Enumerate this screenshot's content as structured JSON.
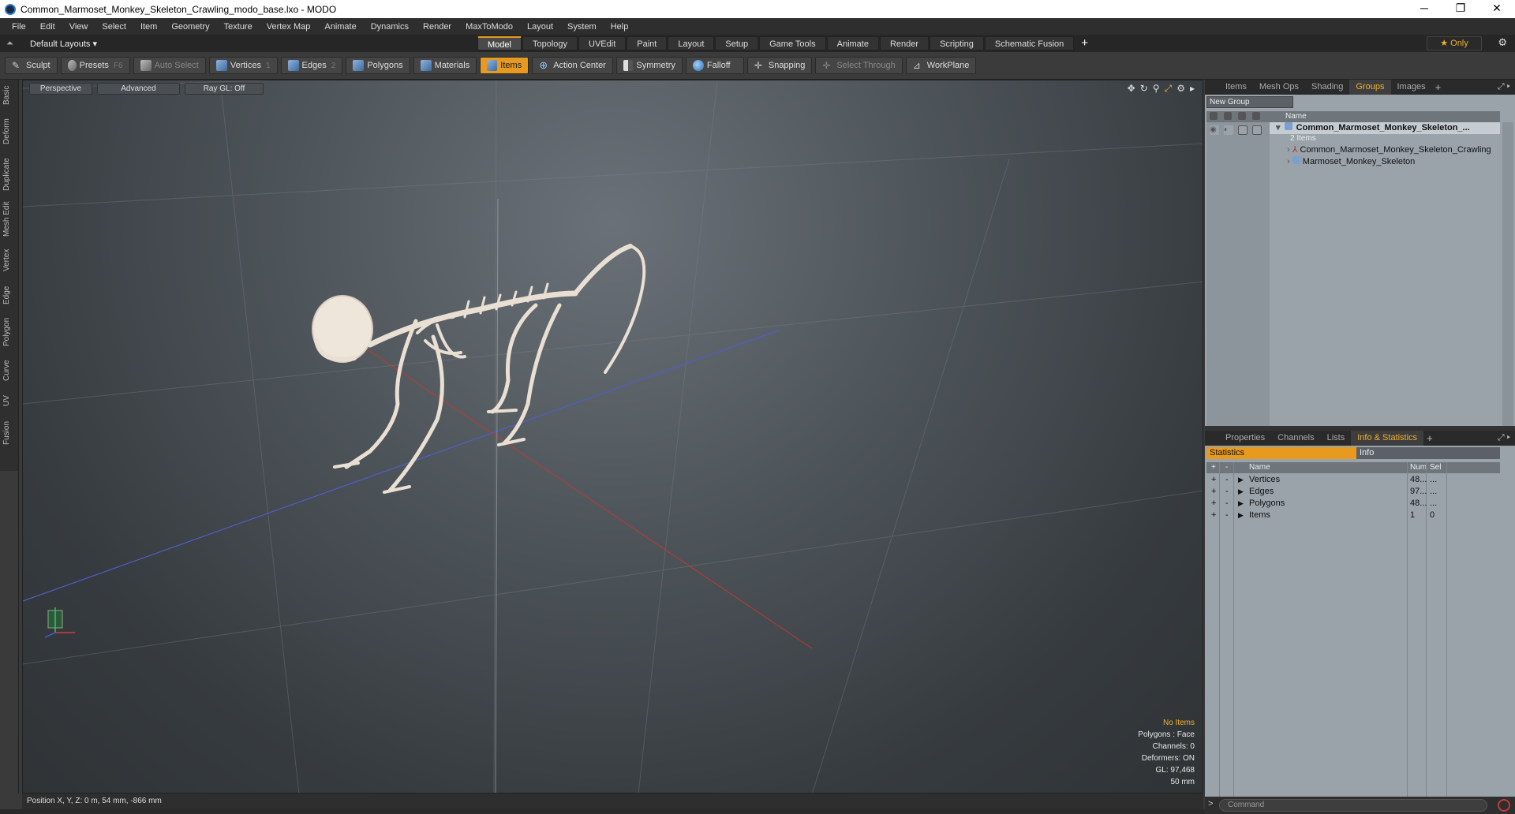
{
  "window": {
    "title": "Common_Marmoset_Monkey_Skeleton_Crawling_modo_base.lxo - MODO",
    "minimize": "─",
    "maximize": "❐",
    "close": "✕"
  },
  "menu": [
    "File",
    "Edit",
    "View",
    "Select",
    "Item",
    "Geometry",
    "Texture",
    "Vertex Map",
    "Animate",
    "Dynamics",
    "Render",
    "MaxToModo",
    "Layout",
    "System",
    "Help"
  ],
  "layout_bar": {
    "layout_label": "Default Layouts ▾",
    "mode_tabs": [
      "Model",
      "Topology",
      "UVEdit",
      "Paint",
      "Layout",
      "Setup",
      "Game Tools",
      "Animate",
      "Render",
      "Scripting",
      "Schematic Fusion"
    ],
    "active_mode": "Model",
    "add_tab": "+",
    "only_label": "★  Only"
  },
  "toolbar": {
    "sculpt": "Sculpt",
    "presets": "Presets",
    "presets_key": "F6",
    "auto_select": "Auto Select",
    "vertices": "Vertices",
    "vertices_count": "1",
    "edges": "Edges",
    "edges_count": "2",
    "polygons": "Polygons",
    "materials": "Materials",
    "items": "Items",
    "action_center": "Action Center",
    "symmetry": "Symmetry",
    "falloff": "Falloff",
    "snapping": "Snapping",
    "select_through": "Select Through",
    "workplane": "WorkPlane"
  },
  "left_tabs": [
    "Basic",
    "Deform",
    "Duplicate",
    "Mesh Edit",
    "Vertex",
    "Edge",
    "Polygon",
    "Curve",
    "UV",
    "Fusion"
  ],
  "viewport": {
    "view_mode": "Perspective",
    "shading": "Advanced",
    "raygl": "Ray GL: Off",
    "info": {
      "selection": "No Items",
      "polygons": "Polygons : Face",
      "channels": "Channels: 0",
      "deformers": "Deformers: ON",
      "gl": "GL: 97,468",
      "scale": "50 mm"
    },
    "icons": [
      "move-icon",
      "rotate-icon",
      "zoom-icon",
      "fit-icon",
      "settings-icon",
      "play-icon"
    ]
  },
  "status_bar": {
    "position": "Position X, Y, Z:   0 m, 54 mm, -866 mm"
  },
  "groups_panel": {
    "tabs": [
      "Items",
      "Mesh Ops",
      "Shading",
      "Groups",
      "Images"
    ],
    "active_tab": "Groups",
    "new_group": "New Group",
    "header_name": "Name",
    "rows": [
      {
        "label": "Common_Marmoset_Monkey_Skeleton_...",
        "sub": "2 Items"
      },
      {
        "label": "Common_Marmoset_Monkey_Skeleton_Crawling"
      },
      {
        "label": "Marmoset_Monkey_Skeleton"
      }
    ]
  },
  "stats_panel": {
    "tabs": [
      "Properties",
      "Channels",
      "Lists",
      "Info & Statistics"
    ],
    "active_tab": "Info & Statistics",
    "sub_tabs": [
      "Statistics",
      "Info"
    ],
    "headers": {
      "name": "Name",
      "num": "Num",
      "sel": "Sel"
    },
    "rows": [
      {
        "name": "Vertices",
        "num": "48...",
        "sel": "..."
      },
      {
        "name": "Edges",
        "num": "97...",
        "sel": "..."
      },
      {
        "name": "Polygons",
        "num": "48...",
        "sel": "..."
      },
      {
        "name": "Items",
        "num": "1",
        "sel": "0"
      }
    ]
  },
  "command": {
    "prompt": ">",
    "placeholder": "Command"
  }
}
